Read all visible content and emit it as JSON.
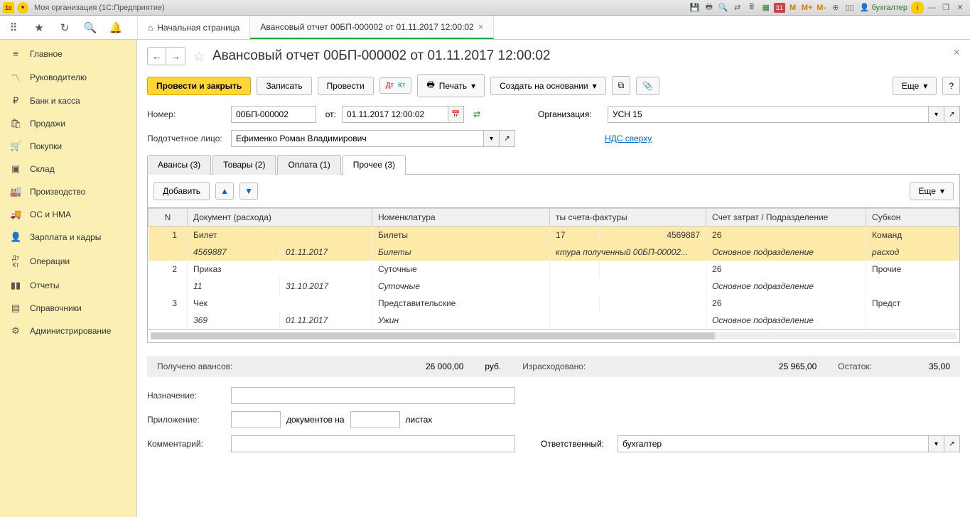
{
  "titlebar": {
    "title": "Моя организация  (1С:Предприятие)",
    "user": "бухгалтер",
    "m": "M",
    "mplus": "M+",
    "mminus": "M-"
  },
  "tabs": {
    "home": "Начальная страница",
    "doc": "Авансовый отчет 00БП-000002 от 01.11.2017 12:00:02"
  },
  "sidebar": {
    "items": [
      {
        "label": "Главное"
      },
      {
        "label": "Руководителю"
      },
      {
        "label": "Банк и касса"
      },
      {
        "label": "Продажи"
      },
      {
        "label": "Покупки"
      },
      {
        "label": "Склад"
      },
      {
        "label": "Производство"
      },
      {
        "label": "ОС и НМА"
      },
      {
        "label": "Зарплата и кадры"
      },
      {
        "label": "Операции"
      },
      {
        "label": "Отчеты"
      },
      {
        "label": "Справочники"
      },
      {
        "label": "Администрирование"
      }
    ]
  },
  "doc": {
    "title": "Авансовый отчет 00БП-000002 от 01.11.2017 12:00:02",
    "toolbar": {
      "post_close": "Провести и закрыть",
      "write": "Записать",
      "post": "Провести",
      "print": "Печать",
      "create_based": "Создать на основании",
      "more": "Еще"
    },
    "fields": {
      "number_label": "Номер:",
      "number": "00БП-000002",
      "from_label": "от:",
      "date": "01.11.2017 12:00:02",
      "org_label": "Организация:",
      "org": "УСН 15",
      "person_label": "Подотчетное лицо:",
      "person": "Ефименко Роман Владимирович",
      "vat_link": "НДС сверху"
    },
    "doc_tabs": {
      "advances": "Авансы (3)",
      "goods": "Товары (2)",
      "payment": "Оплата (1)",
      "other": "Прочее (3)"
    },
    "subtoolbar": {
      "add": "Добавить",
      "more": "Еще"
    },
    "grid": {
      "headers": {
        "n": "N",
        "doc": "Документ (расхода)",
        "nomenclature": "Номенклатура",
        "invoice": "ты счета-фактуры",
        "account": "Счет затрат / Подразделение",
        "subkonto": "Субкон"
      },
      "rows": [
        {
          "n": "1",
          "doc": "Билет",
          "docnum": "4569887",
          "docdate": "01.11.2017",
          "nom": "Билеты",
          "nom2": "Билеты",
          "inv1": "17",
          "inv2": "4569887",
          "inv3": "ктура полученный 00БП-00002...",
          "acc": "26",
          "acc2": "Основное подразделение",
          "sub": "Команд\nрасход"
        },
        {
          "n": "2",
          "doc": "Приказ",
          "docnum": "11",
          "docdate": "31.10.2017",
          "nom": "Суточные",
          "nom2": "Суточные",
          "inv1": "",
          "inv2": "",
          "inv3": "",
          "acc": "26",
          "acc2": "Основное подразделение",
          "sub": "Прочие"
        },
        {
          "n": "3",
          "doc": "Чек",
          "docnum": "369",
          "docdate": "01.11.2017",
          "nom": "Представительские",
          "nom2": "Ужин",
          "inv1": "",
          "inv2": "",
          "inv3": "",
          "acc": "26",
          "acc2": "Основное подразделение",
          "sub": "Предст"
        }
      ]
    },
    "summary": {
      "received_label": "Получено авансов:",
      "received": "26 000,00",
      "currency": "руб.",
      "spent_label": "Израсходовано:",
      "spent": "25 965,00",
      "rest_label": "Остаток:",
      "rest": "35,00"
    },
    "footer": {
      "purpose_label": "Назначение:",
      "attach_label": "Приложение:",
      "attach_docs": "документов на",
      "attach_sheets": "листах",
      "comment_label": "Комментарий:",
      "responsible_label": "Ответственный:",
      "responsible": "бухгалтер"
    }
  }
}
